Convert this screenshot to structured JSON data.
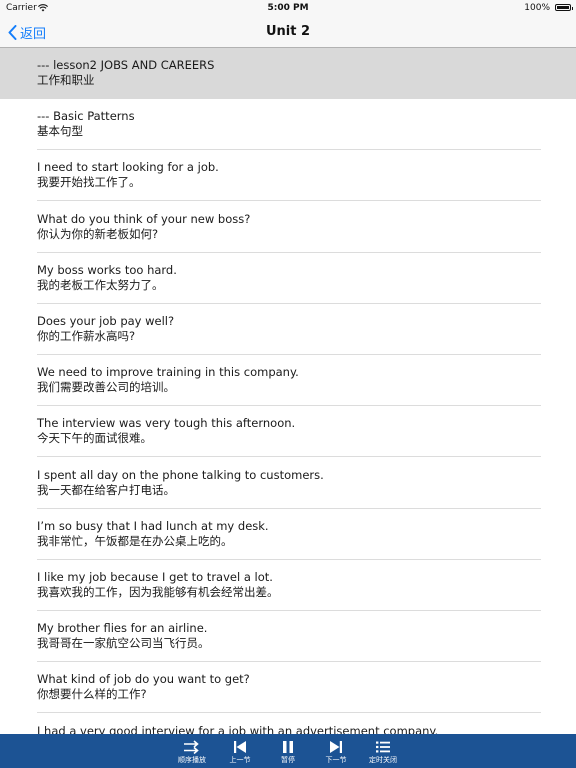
{
  "status_bar": {
    "carrier": "Carrier",
    "time": "5:00 PM",
    "battery": "100%"
  },
  "nav": {
    "back_label": "返回",
    "title": "Unit 2"
  },
  "colors": {
    "accent": "#147efb",
    "toolbar": "#1c5394",
    "selected_row": "#d9d9d9"
  },
  "list": [
    {
      "en": "--- lesson2 JOBS AND CAREERS",
      "zh": "工作和职业",
      "selected": true
    },
    {
      "en": "--- Basic Patterns",
      "zh": "基本句型"
    },
    {
      "en": "I need to start looking for a job.",
      "zh": "我要开始找工作了。"
    },
    {
      "en": "What do you think of your new boss?",
      "zh": "你认为你的新老板如何?"
    },
    {
      "en": "My boss works too hard.",
      "zh": "我的老板工作太努力了。"
    },
    {
      "en": "Does your job pay well?",
      "zh": "你的工作薪水高吗?"
    },
    {
      "en": "We need to improve training in this company.",
      "zh": "我们需要改善公司的培训。"
    },
    {
      "en": "The interview was very tough this afternoon.",
      "zh": "今天下午的面试很难。"
    },
    {
      "en": "I spent all day on the phone talking to customers.",
      "zh": "我一天都在给客户打电话。"
    },
    {
      "en": "I’m so busy that I had lunch at my desk.",
      "zh": "我非常忙，午饭都是在办公桌上吃的。"
    },
    {
      "en": "I like my job because I get to travel a lot.",
      "zh": "我喜欢我的工作，因为我能够有机会经常出差。"
    },
    {
      "en": "My brother flies for an airline.",
      "zh": "我哥哥在一家航空公司当飞行员。"
    },
    {
      "en": "What kind of job do you want to get?",
      "zh": "你想要什么样的工作?"
    },
    {
      "en": "I had a very good interview for a job with an advertisement company.",
      "zh": ""
    }
  ],
  "toolbar": [
    {
      "label": "顺序播放",
      "icon": "sequential-play-icon"
    },
    {
      "label": "上一节",
      "icon": "previous-section-icon"
    },
    {
      "label": "暂停",
      "icon": "pause-icon"
    },
    {
      "label": "下一节",
      "icon": "next-section-icon"
    },
    {
      "label": "定时关闭",
      "icon": "timer-list-icon"
    }
  ]
}
